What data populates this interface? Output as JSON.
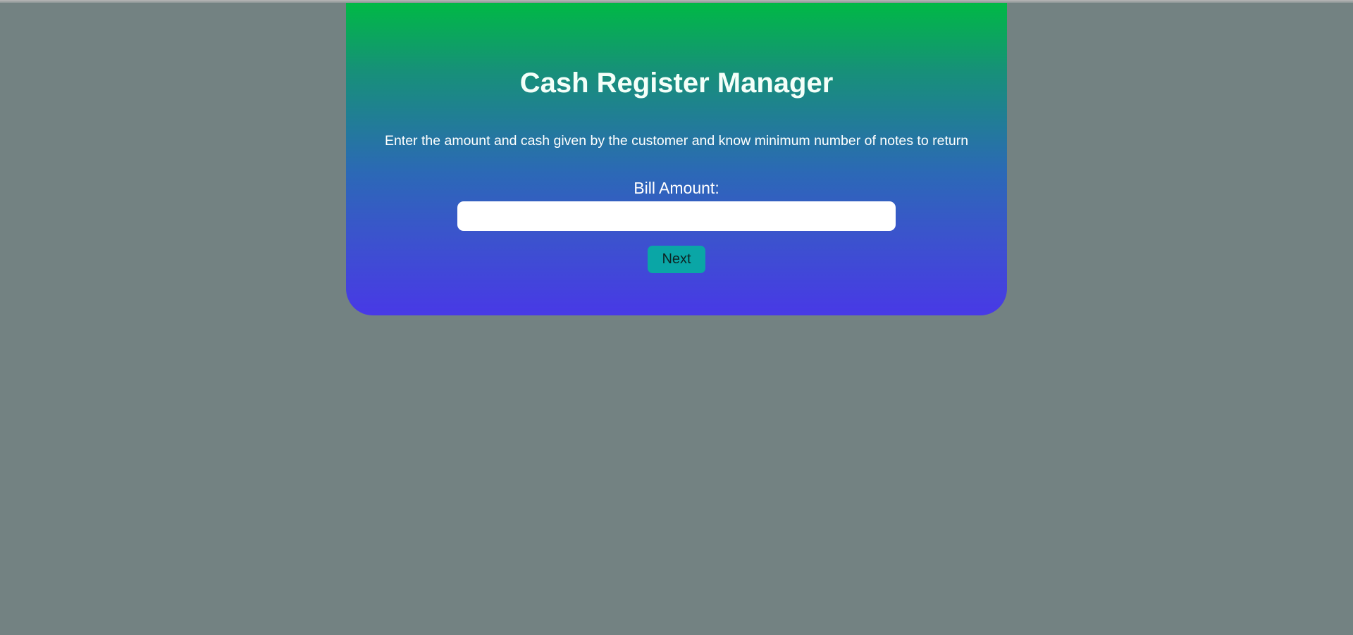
{
  "app": {
    "title": "Cash Register Manager",
    "subtitle": "Enter the amount and cash given by the customer and know minimum number of notes to return"
  },
  "form": {
    "bill_amount_label": "Bill Amount:",
    "bill_amount_value": "",
    "bill_amount_placeholder": "",
    "next_label": "Next"
  },
  "colors": {
    "page_background": "#738282",
    "card_gradient_top": "#00b945",
    "card_gradient_bottom": "#4839e6",
    "button_background": "#0aa6a6",
    "input_background": "#ffffff"
  }
}
